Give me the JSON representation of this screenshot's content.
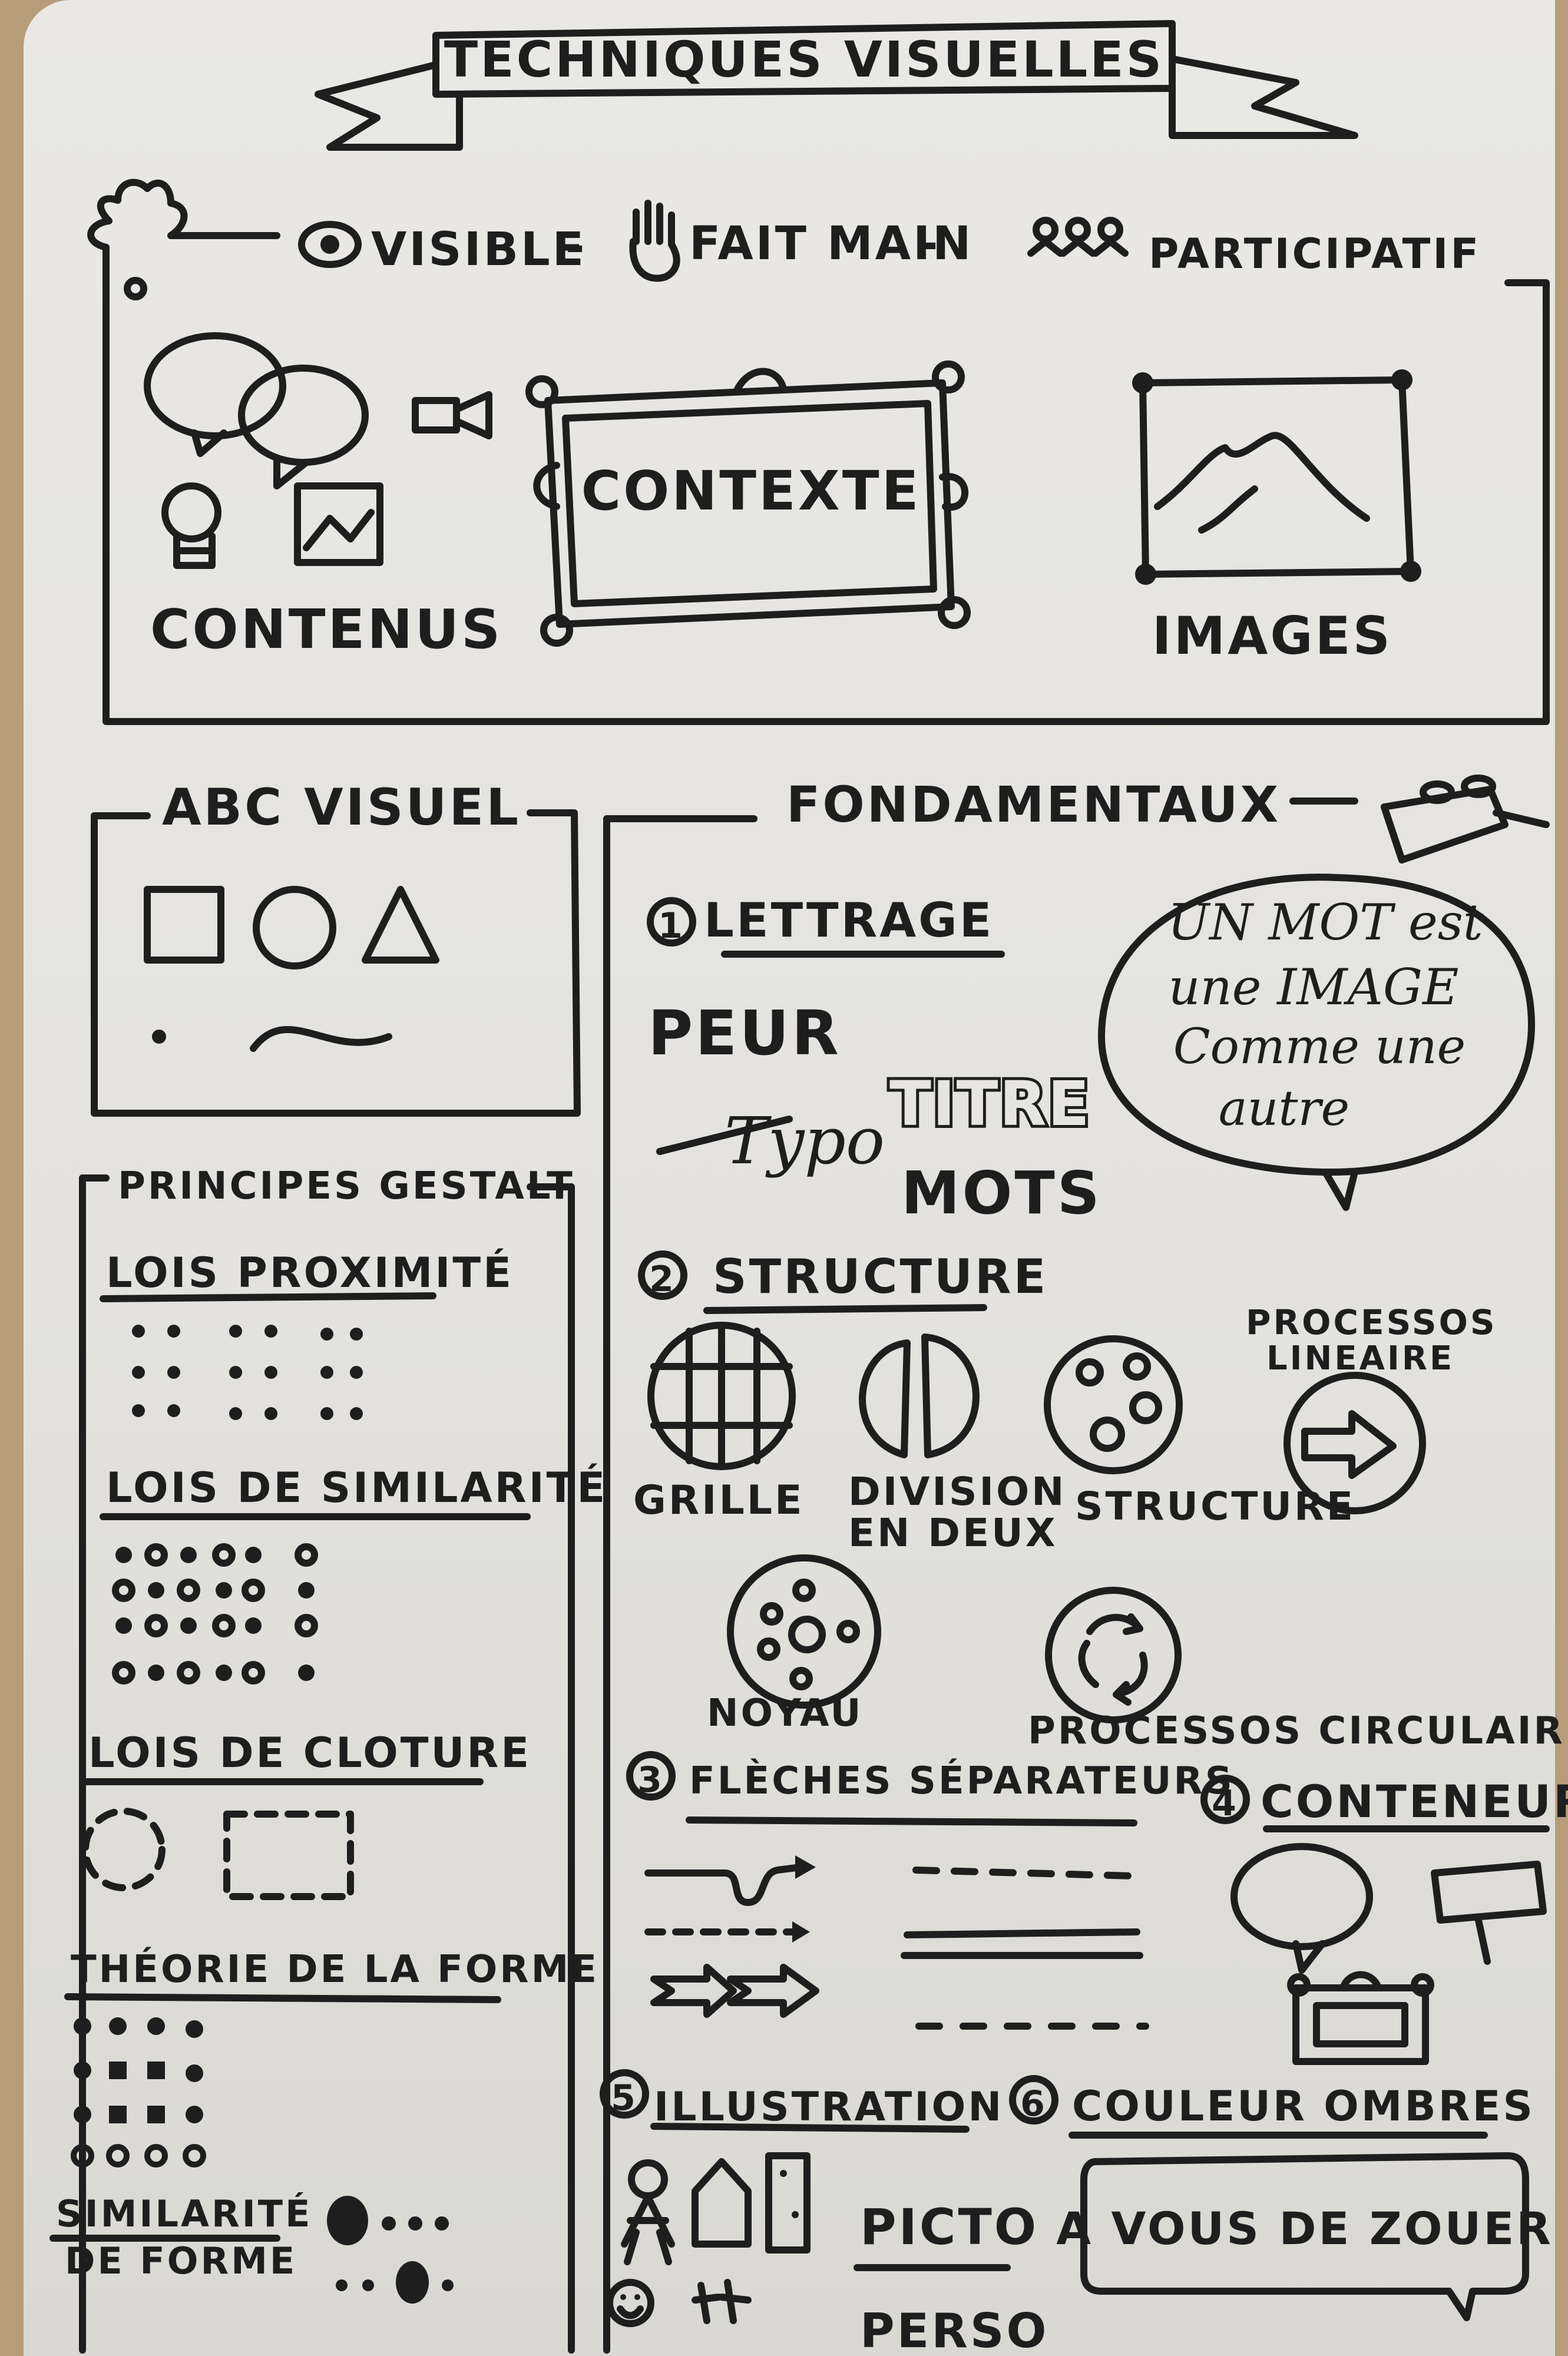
{
  "banner_title": "TECHNIQUES VISUELLES",
  "top_frame": {
    "items": [
      "VISIBLE",
      "FAIT MAIN",
      "PARTICIPATIF"
    ],
    "separator": "-",
    "contenus": "CONTENUS",
    "contexte": "CONTEXTE",
    "images": "IMAGES"
  },
  "abc": {
    "title": "ABC VISUEL"
  },
  "gestalt": {
    "title": "PRINCIPES GESTALT",
    "proximite": "LOIS PROXIMITÉ",
    "similarite": "LOIS DE SIMILARITÉ",
    "cloture": "LOIS DE CLOTURE",
    "theorie": "THÉORIE DE LA FORME",
    "similarite_forme": [
      "SIMILARITÉ",
      "DE FORME"
    ]
  },
  "fondamentaux": {
    "title": "FONDAMENTAUX",
    "bubble": [
      "UN MOT est",
      "une IMAGE",
      "Comme une",
      "autre"
    ],
    "s1": {
      "num": "1",
      "title": "LETTRAGE",
      "words": [
        "PEUR",
        "Typo",
        "TITRE",
        "MOTS"
      ]
    },
    "s2": {
      "num": "2",
      "title": "STRUCTURE",
      "labels": [
        "GRILLE",
        "DIVISION",
        "EN DEUX",
        "STRUCTURE",
        "PROCESSOS",
        "LINEAIRE",
        "NOYAU",
        "PROCESSOS CIRCULAIR"
      ]
    },
    "s3": {
      "num": "3",
      "title": "FLÈCHES SÉPARATEURS"
    },
    "s4": {
      "num": "4",
      "title": "CONTENEURS"
    },
    "s5": {
      "num": "5",
      "title": "ILLUSTRATION",
      "picto": "PICTO",
      "perso": "PERSO"
    },
    "s6": {
      "num": "6",
      "title": "COULEUR OMBRES",
      "cta": "A VOUS DE ZOUER"
    }
  }
}
